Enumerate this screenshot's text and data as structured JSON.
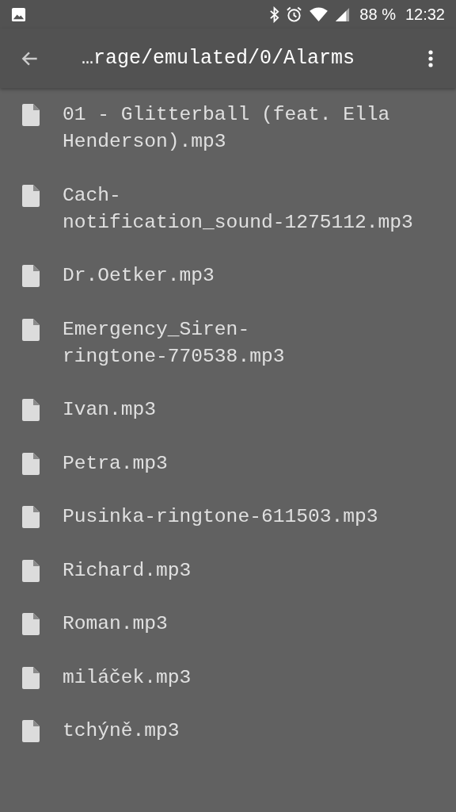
{
  "status_bar": {
    "battery": "88 %",
    "time": "12:32"
  },
  "toolbar": {
    "title": "…rage/emulated/0/Alarms"
  },
  "files": [
    {
      "lines": [
        "01 - Glitterball (feat. Ella",
        "Henderson).mp3"
      ]
    },
    {
      "lines": [
        "Cach-",
        "notification_sound-1275112.mp3"
      ]
    },
    {
      "lines": [
        "Dr.Oetker.mp3"
      ]
    },
    {
      "lines": [
        "Emergency_Siren-",
        "ringtone-770538.mp3"
      ]
    },
    {
      "lines": [
        "Ivan.mp3"
      ]
    },
    {
      "lines": [
        "Petra.mp3"
      ]
    },
    {
      "lines": [
        "Pusinka-ringtone-611503.mp3"
      ]
    },
    {
      "lines": [
        "Richard.mp3"
      ]
    },
    {
      "lines": [
        "Roman.mp3"
      ]
    },
    {
      "lines": [
        "miláček.mp3"
      ]
    },
    {
      "lines": [
        "tchýně.mp3"
      ]
    }
  ]
}
